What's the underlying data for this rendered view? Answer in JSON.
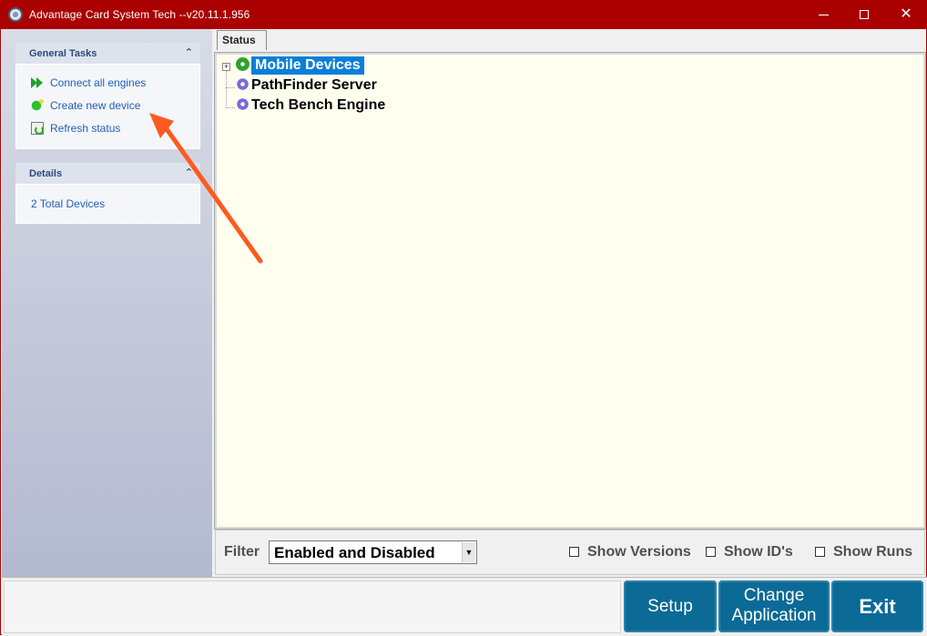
{
  "window": {
    "title": "Advantage Card System Tech --v20.11.1.956",
    "controls": [
      "minimize",
      "maximize",
      "close"
    ]
  },
  "sidebar": {
    "general_tasks": {
      "title": "General Tasks",
      "items": [
        {
          "label": "Connect all engines",
          "icon": "double-play-icon"
        },
        {
          "label": "Create new device",
          "icon": "new-device-icon"
        },
        {
          "label": "Refresh status",
          "icon": "refresh-icon"
        }
      ]
    },
    "details": {
      "title": "Details",
      "text": "2 Total Devices"
    }
  },
  "main": {
    "tab_label": "Status",
    "tree": [
      {
        "label": "Mobile Devices",
        "selected": true,
        "expandable": true,
        "icon": "green-gear-icon"
      },
      {
        "label": "PathFinder Server",
        "selected": false,
        "expandable": false,
        "icon": "purple-gear-icon"
      },
      {
        "label": "Tech Bench Engine",
        "selected": false,
        "expandable": false,
        "icon": "purple-gear-icon"
      }
    ],
    "filter": {
      "label": "Filter",
      "selected": "Enabled and Disabled"
    },
    "options": [
      {
        "label": "Show Versions",
        "checked": false
      },
      {
        "label": "Show ID's",
        "checked": false
      },
      {
        "label": "Show Runs",
        "checked": false
      }
    ]
  },
  "commands": {
    "setup": "Setup",
    "change_line1": "Change",
    "change_line2": "Application",
    "exit": "Exit"
  },
  "colors": {
    "title_bar": "#aa0000",
    "selection": "#0a7fd8",
    "command_button": "#0b6a96",
    "annotation_arrow": "#ff5a1f"
  }
}
